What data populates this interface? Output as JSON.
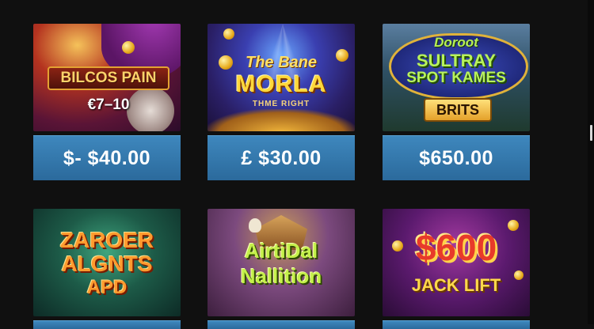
{
  "games": [
    {
      "title": "BILCOS PAIN",
      "subtitle": "€7–10",
      "price": "$- $40.00"
    },
    {
      "title_line1": "The Bane",
      "title_line2": "MORLA",
      "subtitle": "THME RIGHT",
      "price": "£  $30.00"
    },
    {
      "title_line1": "Doroot",
      "title_line2": "SULTRAY",
      "title_line3": "SPOT KAMES",
      "badge": "BRITS",
      "price": "$650.00"
    },
    {
      "title_line1": "ZAROER",
      "title_line2": "ALGNTS",
      "title_line3": "APD"
    },
    {
      "title_line1": "AirtiDal",
      "title_line2": "Nallition"
    },
    {
      "title_line1": "$600",
      "title_line2": "JACK LIFT"
    }
  ],
  "colors": {
    "button": "#3478ae",
    "background": "#101010"
  }
}
